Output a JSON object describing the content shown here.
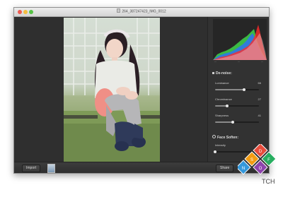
{
  "window": {
    "title": "264_387247423_IMG_0012"
  },
  "footer": {
    "import_label": "Import",
    "share_label": "Share"
  },
  "histogram": {
    "ticks": [
      "—",
      "—",
      "—"
    ]
  },
  "denoise": {
    "title": "De-noise:",
    "luminance": {
      "label": "Luminance",
      "value": 66
    },
    "chrominance": {
      "label": "Chrominance",
      "value": 27
    },
    "sharpness": {
      "label": "Sharpness",
      "value": 41
    }
  },
  "face_soften": {
    "title": "Face Soften:",
    "intensity": {
      "label": "Intensity",
      "value": 0
    }
  },
  "badge": {
    "letters": [
      "D",
      "S",
      "F",
      "O",
      "N"
    ],
    "tail": "TCH"
  },
  "colors": {
    "histogram": [
      "#ff2b2b",
      "#3fd34a",
      "#2f6dff",
      "#f2f2f2"
    ],
    "badge": [
      "#e74c3c",
      "#f39c12",
      "#27ae60",
      "#8e44ad",
      "#3498db"
    ]
  }
}
